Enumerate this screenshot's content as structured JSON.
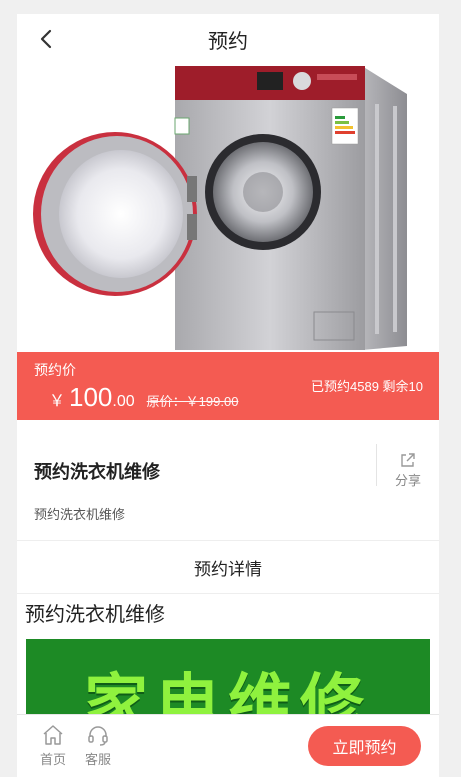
{
  "header": {
    "title": "预约"
  },
  "price": {
    "label": "预约价",
    "currency": "￥",
    "integer": "100",
    "decimal": ".00",
    "original": "原价：￥199.00",
    "stats": "已预约4589 剩余10"
  },
  "product": {
    "name": "预约洗衣机维修",
    "description": "预约洗衣机维修",
    "share_label": "分享"
  },
  "details": {
    "tab_label": "预约详情",
    "title": "预约洗衣机维修",
    "banner_text": "家电维修"
  },
  "bottom_bar": {
    "home_label": "首页",
    "service_label": "客服",
    "book_label": "立即预约"
  },
  "colors": {
    "accent": "#f45b52",
    "banner_bg": "#1d8a25",
    "banner_text": "#8ff23e"
  }
}
